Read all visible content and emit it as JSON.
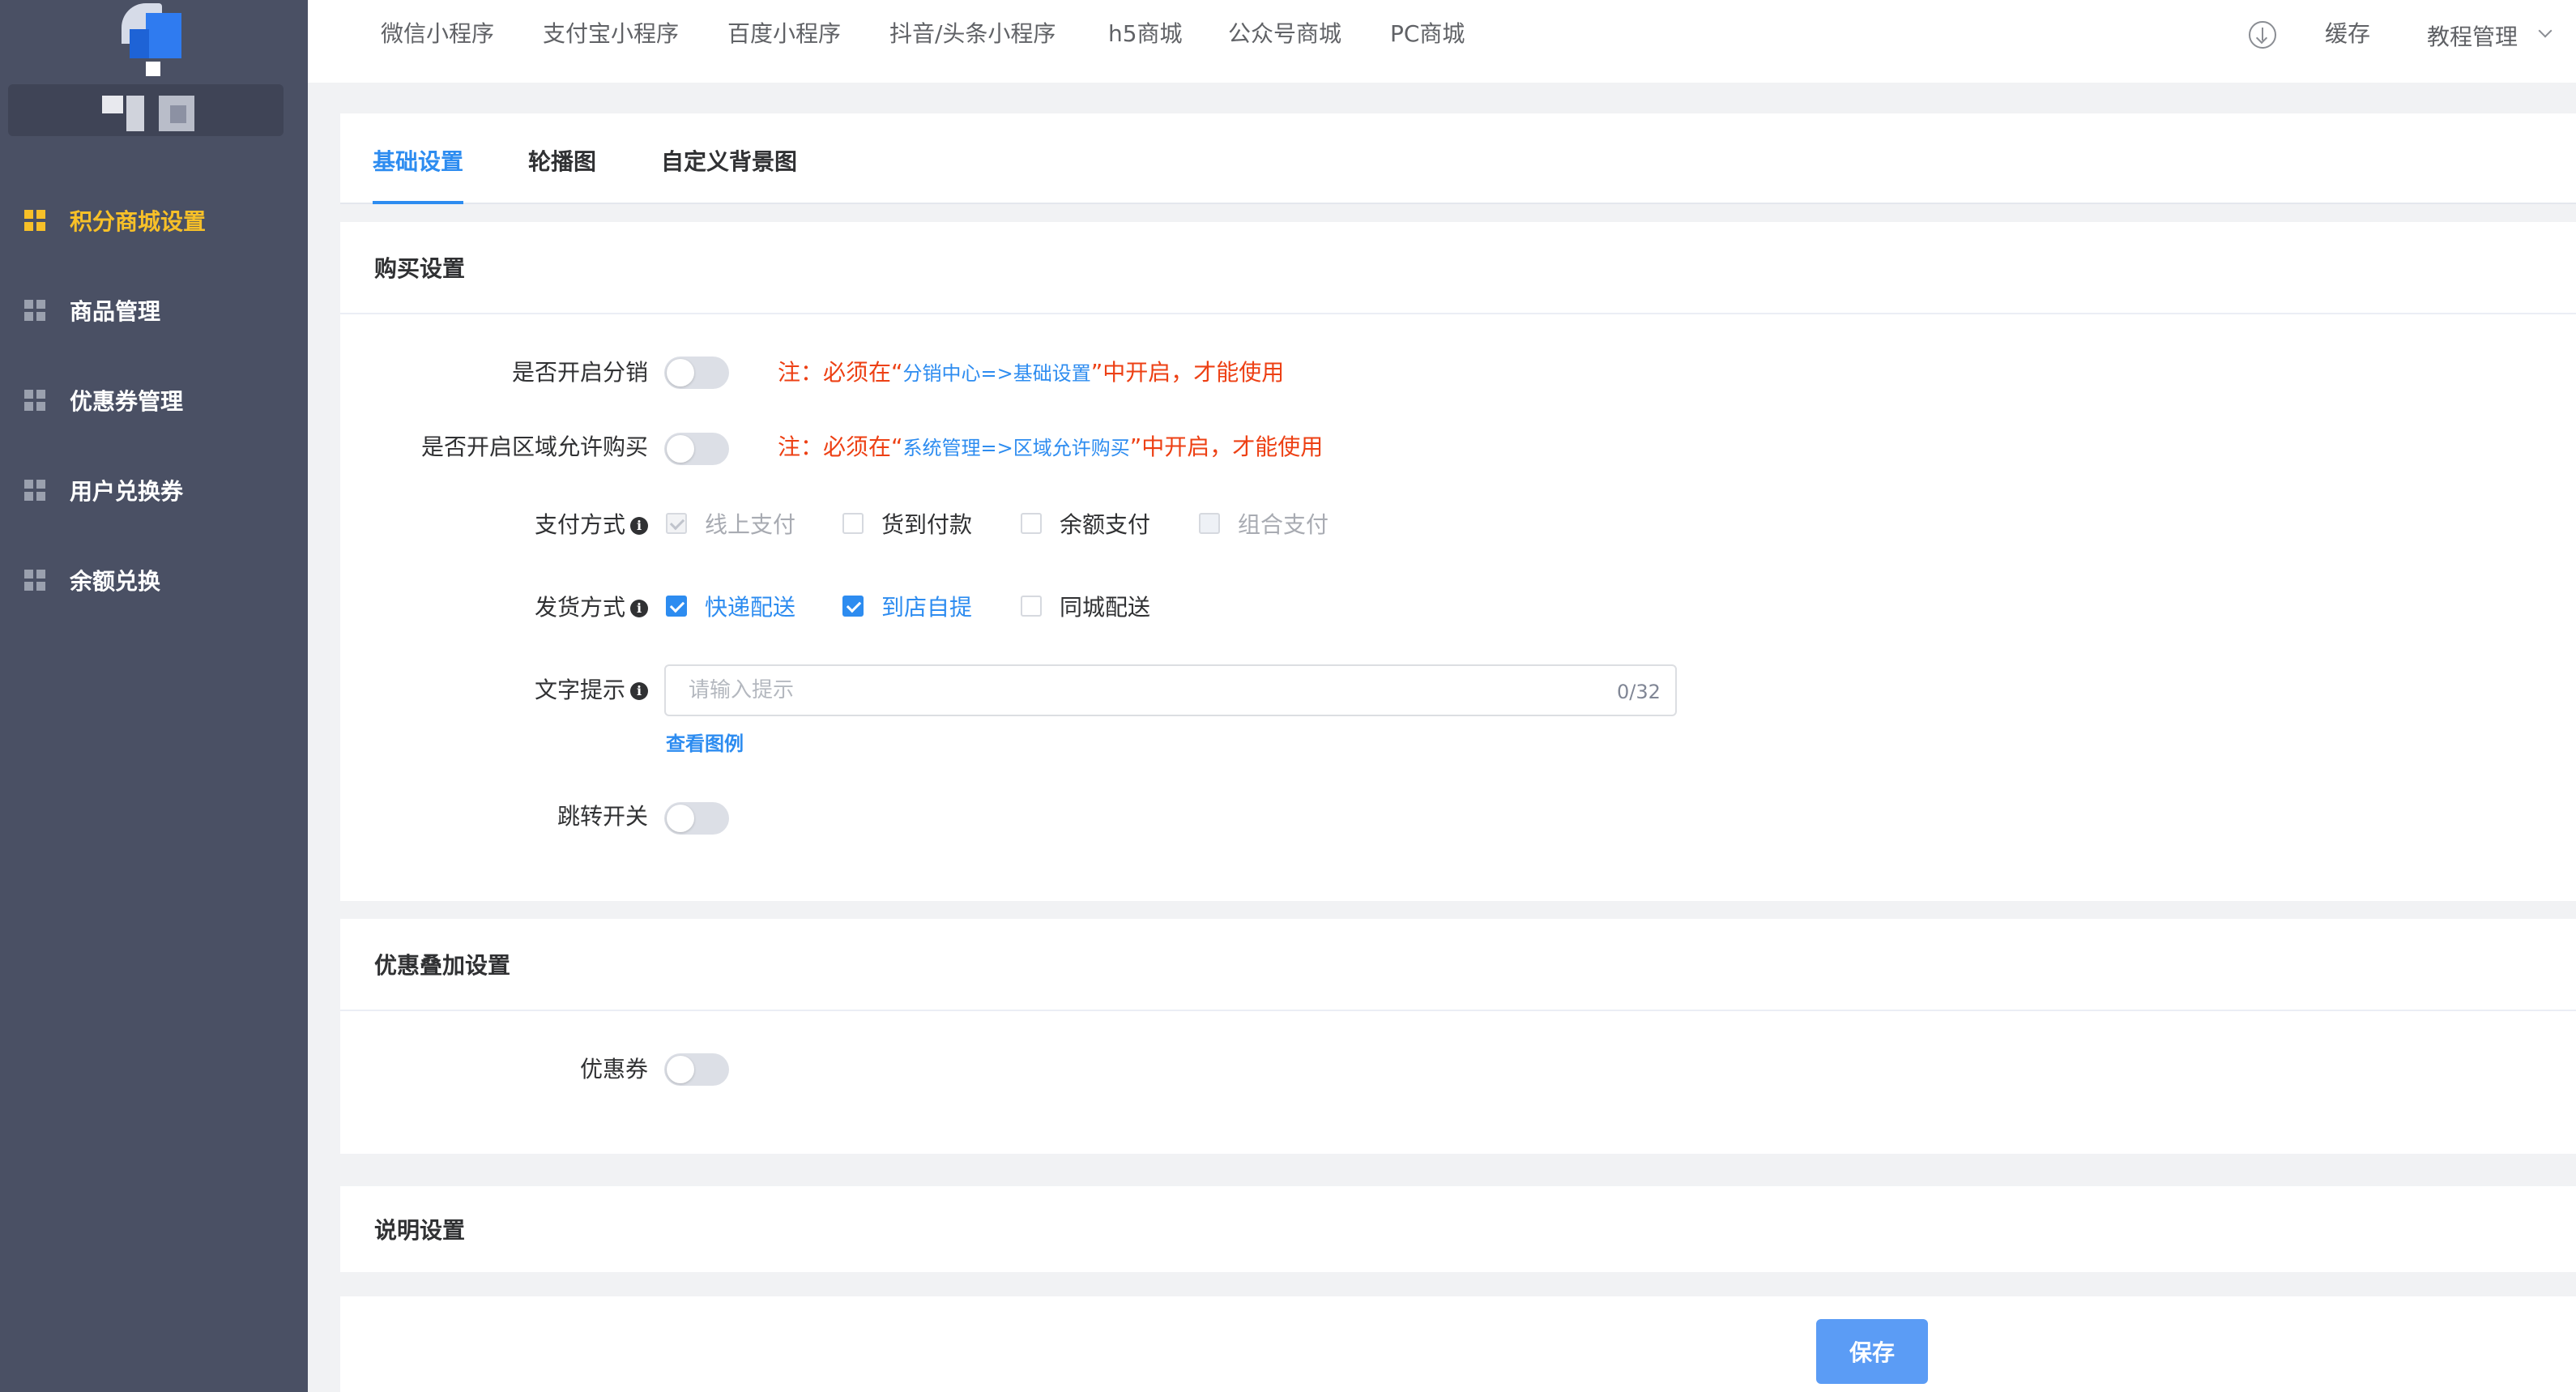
{
  "sidebar": {
    "items": [
      {
        "label": "积分商城设置",
        "active": true
      },
      {
        "label": "商品管理"
      },
      {
        "label": "优惠券管理"
      },
      {
        "label": "用户兑换券"
      },
      {
        "label": "余额兑换"
      }
    ]
  },
  "topnav": {
    "tabs": [
      "微信小程序",
      "支付宝小程序",
      "百度小程序",
      "抖音/头条小程序",
      "h5商城",
      "公众号商城",
      "PC商城"
    ],
    "cache_label": "缓存",
    "tutorial_label": "教程管理"
  },
  "subtabs": [
    "基础设置",
    "轮播图",
    "自定义背景图"
  ],
  "purchase": {
    "title": "购买设置",
    "distribution_label": "是否开启分销",
    "distribution_note_pre": "注：必须在“",
    "distribution_note_link": "分销中心=>基础设置",
    "distribution_note_post": "”中开启，才能使用",
    "region_label": "是否开启区域允许购买",
    "region_note_pre": "注：必须在“",
    "region_note_link": "系统管理=>区域允许购买",
    "region_note_post": "”中开启，才能使用",
    "payment_label": "支付方式",
    "payment_options": [
      "线上支付",
      "货到付款",
      "余额支付",
      "组合支付"
    ],
    "delivery_label": "发货方式",
    "delivery_options": [
      "快递配送",
      "到店自提",
      "同城配送"
    ],
    "tip_label": "文字提示",
    "tip_placeholder": "请输入提示",
    "tip_counter": "0/32",
    "example_link": "查看图例",
    "redirect_label": "跳转开关"
  },
  "discount": {
    "title": "优惠叠加设置",
    "coupon_label": "优惠券"
  },
  "description": {
    "title": "说明设置"
  },
  "footer": {
    "save_label": "保存"
  },
  "colors": {
    "sidebar_bg": "#4a5064",
    "active_menu": "#f7c028",
    "primary": "#2d8cf0",
    "note_red": "#ed4014"
  }
}
